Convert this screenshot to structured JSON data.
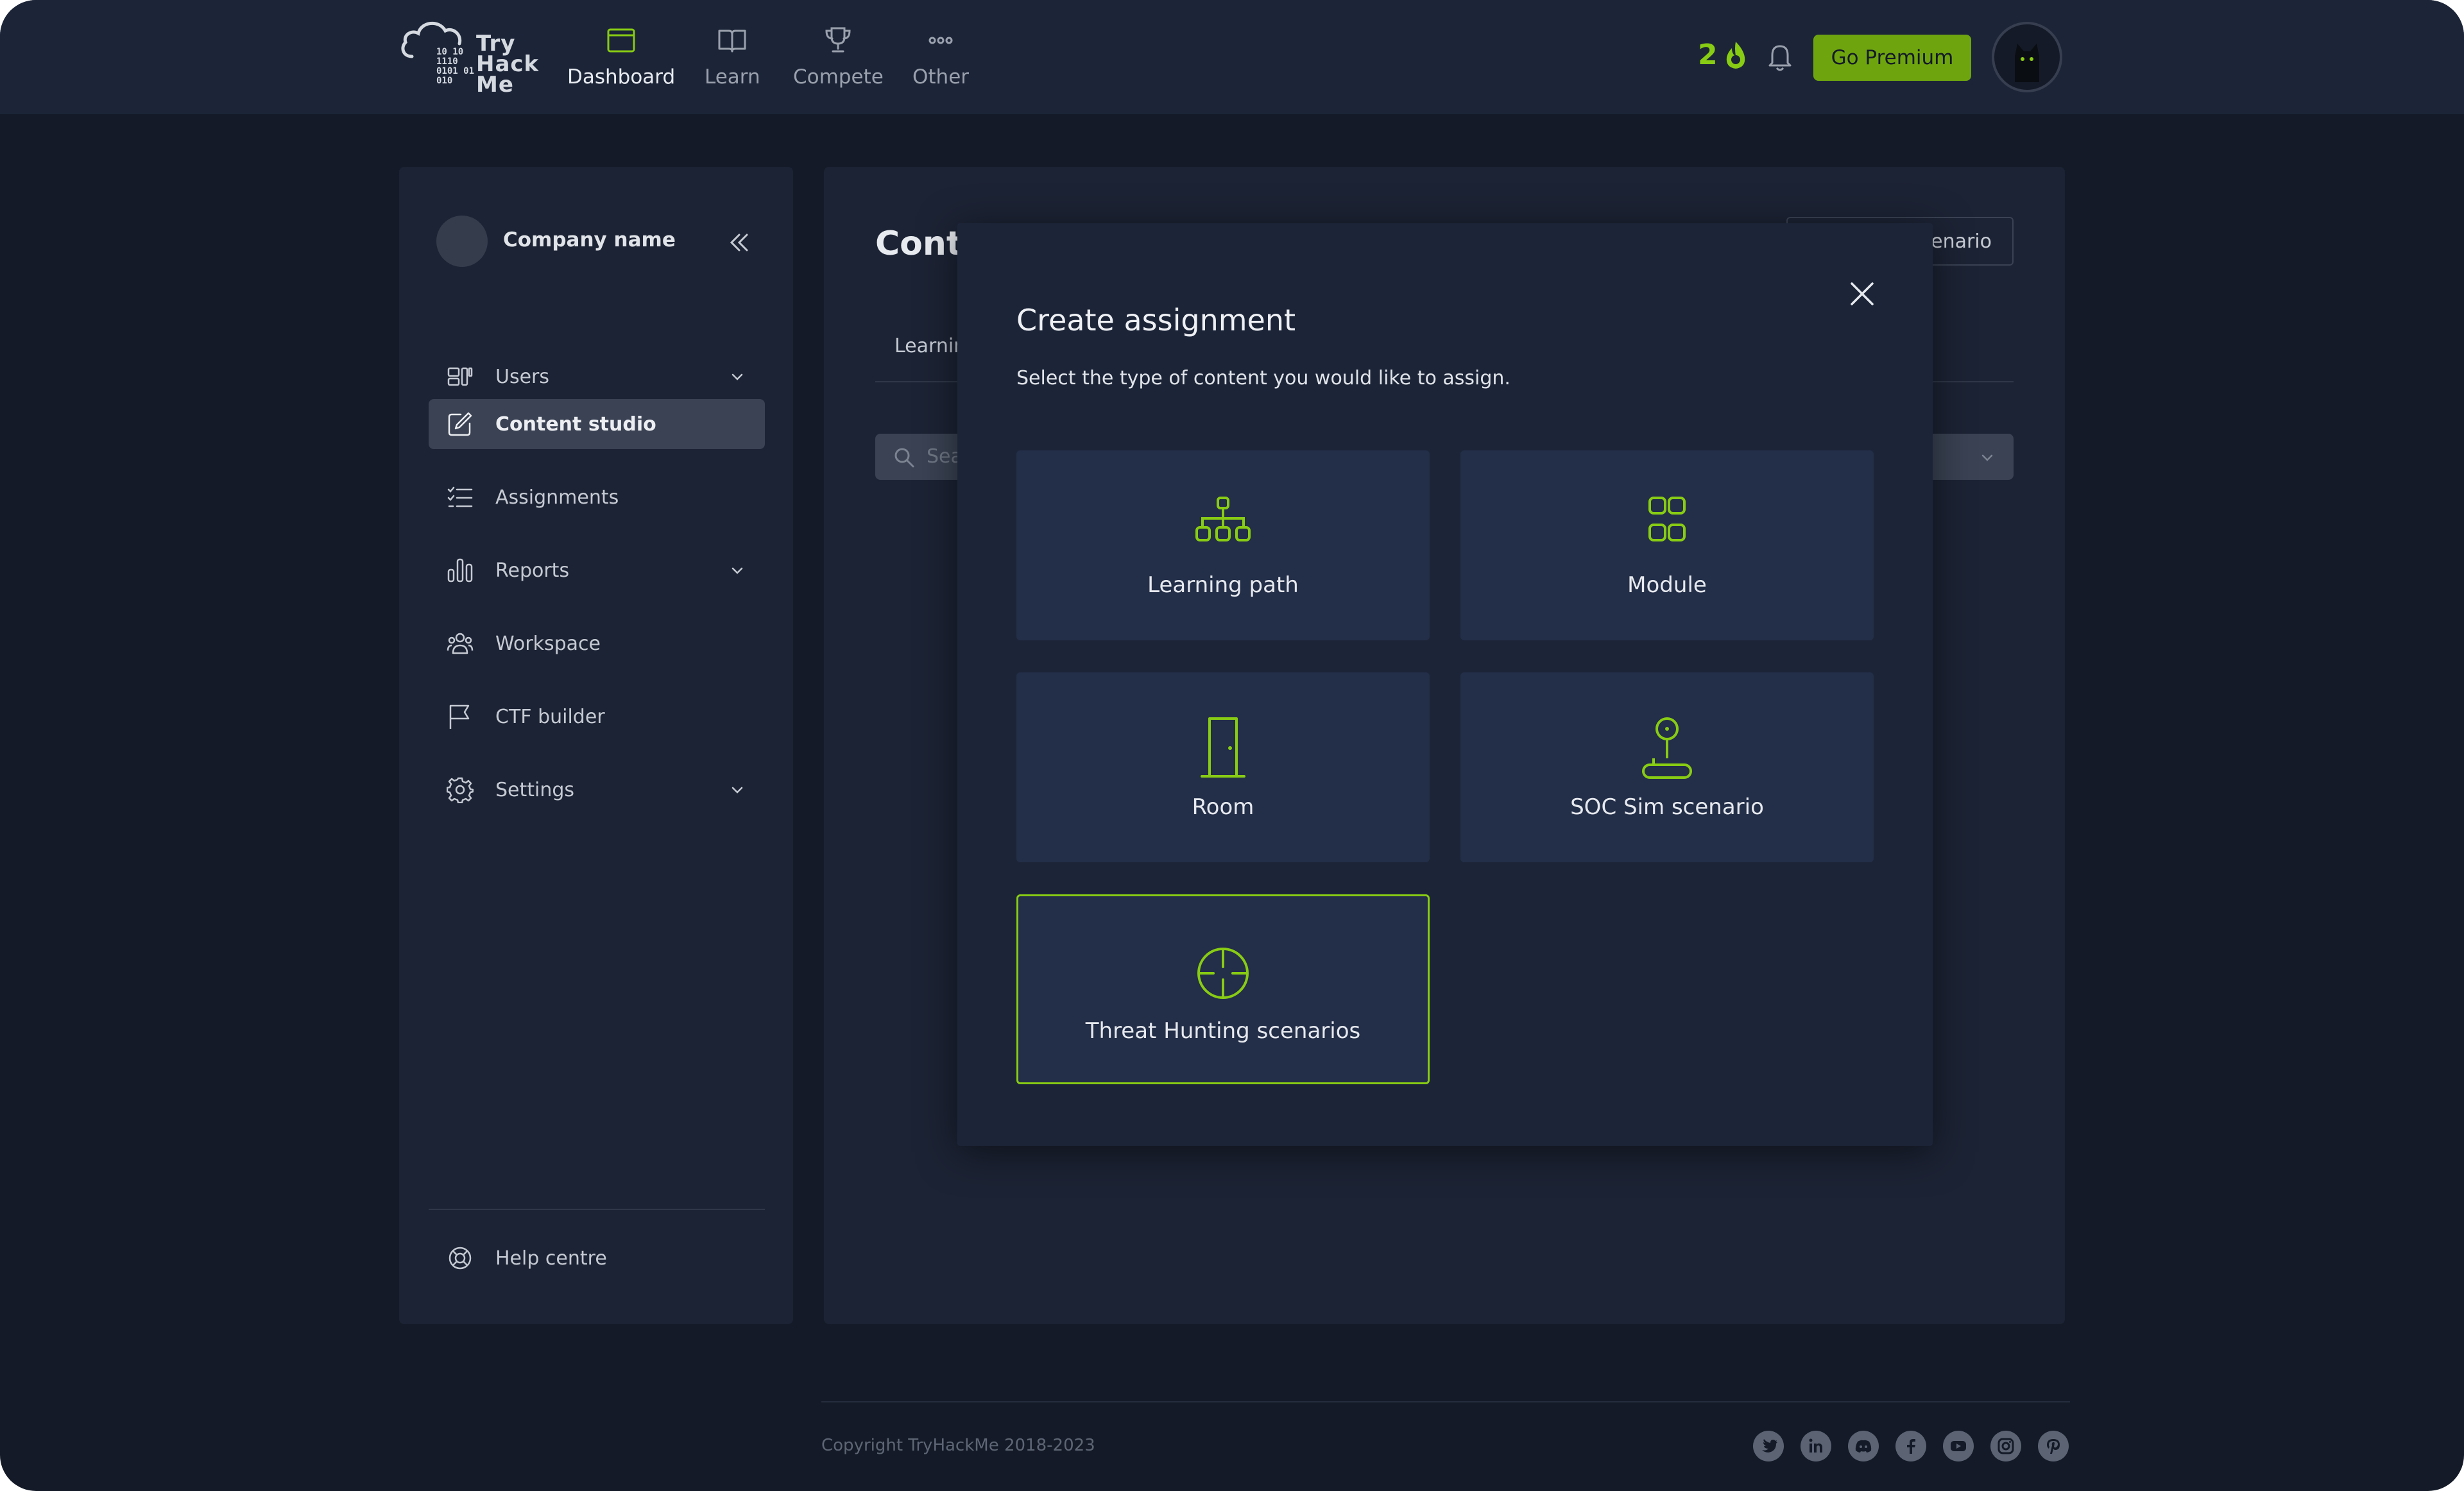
{
  "nav": {
    "logo_text": [
      "Try",
      "Hack",
      "Me"
    ],
    "logo_bits": [
      "10 10",
      "1110",
      "0101 01",
      "010"
    ],
    "items": [
      {
        "label": "Dashboard",
        "icon": "dashboard-icon",
        "active": true
      },
      {
        "label": "Learn",
        "icon": "book-icon",
        "active": false
      },
      {
        "label": "Compete",
        "icon": "trophy-icon",
        "active": false
      },
      {
        "label": "Other",
        "icon": "more-dots-icon",
        "active": false
      }
    ],
    "streak_count": "2",
    "premium_label": "Go Premium"
  },
  "sidebar": {
    "company_name": "Company name",
    "items": [
      {
        "label": "Users",
        "icon": "users-icon",
        "has_chevron": true,
        "active": false
      },
      {
        "label": "Content studio",
        "icon": "edit-icon",
        "has_chevron": false,
        "active": true
      },
      {
        "label": "Assignments",
        "icon": "checklist-icon",
        "has_chevron": false,
        "active": false
      },
      {
        "label": "Reports",
        "icon": "bar-chart-icon",
        "has_chevron": true,
        "active": false
      },
      {
        "label": "Workspace",
        "icon": "team-icon",
        "has_chevron": false,
        "active": false
      },
      {
        "label": "CTF builder",
        "icon": "flag-icon",
        "has_chevron": false,
        "active": false
      },
      {
        "label": "Settings",
        "icon": "gear-icon",
        "has_chevron": true,
        "active": false
      }
    ],
    "help_label": "Help centre"
  },
  "main": {
    "title_partial": "Conte",
    "scenario_button_partial": "enario",
    "tab_partial": "Learnin",
    "search_placeholder_partial": "Sea"
  },
  "modal": {
    "title": "Create assignment",
    "subtitle": "Select the type of content you would like to assign.",
    "options": [
      {
        "label": "Learning path",
        "icon": "hierarchy-icon",
        "selected": false
      },
      {
        "label": "Module",
        "icon": "grid-icon",
        "selected": false
      },
      {
        "label": "Room",
        "icon": "door-icon",
        "selected": false
      },
      {
        "label": "SOC Sim scenario",
        "icon": "joystick-icon",
        "selected": false
      },
      {
        "label": "Threat Hunting scenarios",
        "icon": "crosshair-icon",
        "selected": true
      }
    ]
  },
  "footer": {
    "copyright": "Copyright TryHackMe 2018-2023",
    "social": [
      "twitter-icon",
      "linkedin-icon",
      "discord-icon",
      "facebook-icon",
      "youtube-icon",
      "instagram-icon",
      "pinterest-icon"
    ]
  },
  "colors": {
    "accent": "#88cc14",
    "premium_button": "#6ea50f",
    "background": "#141a27",
    "panel": "#1c2334",
    "modal": "#1c2538",
    "card": "#232e48"
  }
}
